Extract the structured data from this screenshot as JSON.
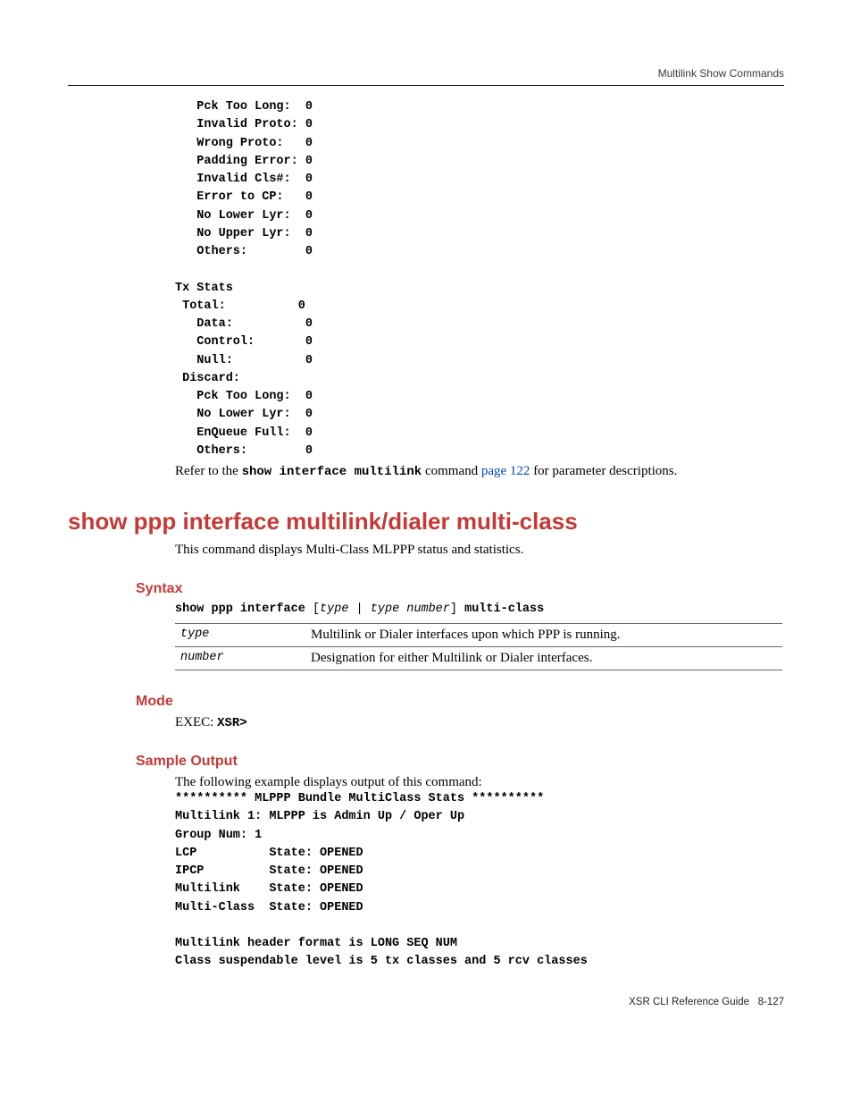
{
  "header": {
    "right": "Multilink Show Commands"
  },
  "preblock": "   Pck Too Long:  0\n   Invalid Proto: 0\n   Wrong Proto:   0\n   Padding Error: 0\n   Invalid Cls#:  0\n   Error to CP:   0\n   No Lower Lyr:  0\n   No Upper Lyr:  0\n   Others:        0\n\nTx Stats\n Total:          0\n   Data:          0\n   Control:       0\n   Null:          0\n Discard:\n   Pck Too Long:  0\n   No Lower Lyr:  0\n   EnQueue Full:  0\n   Others:        0",
  "refer_line": {
    "prefix": "Refer to the ",
    "cmd": "show interface multilink",
    "mid": " command ",
    "link": "page 122",
    "suffix": " for parameter descriptions."
  },
  "title": "show ppp interface multilink/dialer multi-class",
  "intro": "This command displays Multi-Class MLPPP status and statistics.",
  "sections": {
    "syntax": "Syntax",
    "mode": "Mode",
    "sample": "Sample Output"
  },
  "syntax_line": {
    "p1": "show ppp interface ",
    "p2": "[",
    "p3": "type",
    "p4": " | ",
    "p5": "type number",
    "p6": "]",
    "p7": " multi-class"
  },
  "params": [
    {
      "name": "type",
      "desc": "Multilink or Dialer interfaces upon which PPP is running."
    },
    {
      "name": "number",
      "desc": "Designation for either Multilink or Dialer interfaces."
    }
  ],
  "mode_line": {
    "label": "EXEC: ",
    "value": "XSR>"
  },
  "sample_intro": "The following example displays output of this command:",
  "sample_output": "********** MLPPP Bundle MultiClass Stats **********\nMultilink 1: MLPPP is Admin Up / Oper Up\nGroup Num: 1\nLCP          State: OPENED\nIPCP         State: OPENED\nMultilink    State: OPENED\nMulti-Class  State: OPENED\n\nMultilink header format is LONG SEQ NUM\nClass suspendable level is 5 tx classes and 5 rcv classes",
  "footer": {
    "doc": "XSR CLI Reference Guide",
    "page": "8-127"
  }
}
